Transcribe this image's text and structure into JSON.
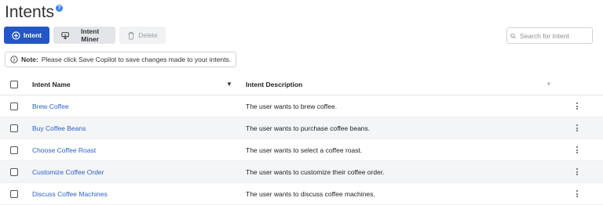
{
  "page": {
    "title": "Intents"
  },
  "toolbar": {
    "intent_label": "Intent",
    "intent_miner_label": "Intent Miner",
    "delete_label": "Delete"
  },
  "search": {
    "placeholder": "Search for Intent"
  },
  "note": {
    "prefix": "Note:",
    "text": "Please click Save Copilot to save changes made to your intents."
  },
  "table": {
    "headers": {
      "name": "Intent Name",
      "description": "Intent Description"
    },
    "rows": [
      {
        "name": "Brew Coffee",
        "description": "The user wants to brew coffee."
      },
      {
        "name": "Buy Coffee Beans",
        "description": "The user wants to purchase coffee beans."
      },
      {
        "name": "Choose Coffee Roast",
        "description": "The user wants to select a coffee roast."
      },
      {
        "name": "Customize Coffee Order",
        "description": "The user wants to customize their coffee order."
      },
      {
        "name": "Discuss Coffee Machines",
        "description": "The user wants to discuss coffee machines."
      }
    ]
  },
  "colors": {
    "primary": "#2457c5",
    "link": "#2a62c9"
  },
  "icons": [
    "help-icon",
    "plus-circle-icon",
    "intent-miner-icon",
    "trash-icon",
    "search-icon",
    "info-icon",
    "sort-icon",
    "kebab-icon"
  ]
}
